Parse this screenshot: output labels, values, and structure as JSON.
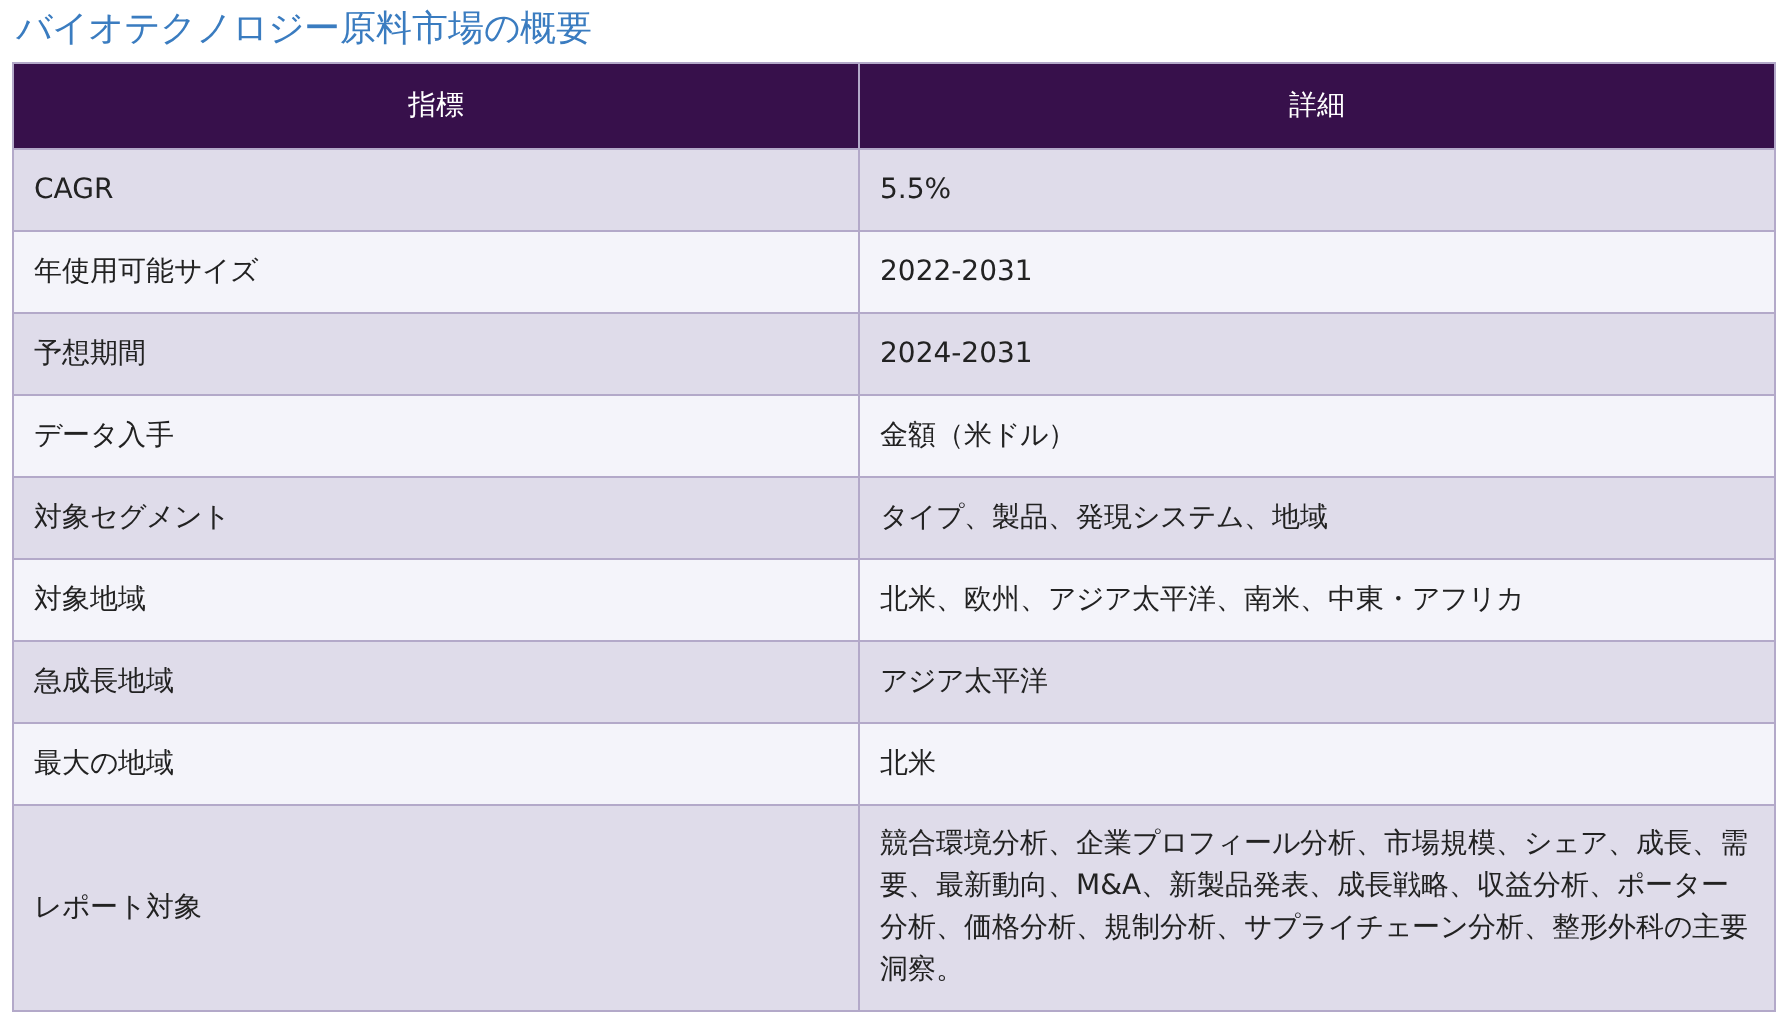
{
  "title": "バイオテクノロジー原料市場の概要",
  "table": {
    "columns": [
      "指標",
      "詳細"
    ],
    "rows": [
      {
        "label": "CAGR",
        "value": "5.5%"
      },
      {
        "label": "年使用可能サイズ",
        "value": "2022-2031"
      },
      {
        "label": "予想期間",
        "value": "2024-2031"
      },
      {
        "label": "データ入手",
        "value": "金額（米ドル）"
      },
      {
        "label": "対象セグメント",
        "value": "タイプ、製品、発現システム、地域"
      },
      {
        "label": "対象地域",
        "value": "北米、欧州、アジア太平洋、南米、中東・アフリカ"
      },
      {
        "label": "急成長地域",
        "value": "アジア太平洋"
      },
      {
        "label": "最大の地域",
        "value": "北米"
      },
      {
        "label": "レポート対象",
        "value": "競合環境分析、企業プロフィール分析、市場規模、シェア、成長、需要、最新動向、M&A、新製品発表、成長戦略、収益分析、ポーター分析、価格分析、規制分析、サプライチェーン分析、整形外科の主要洞察。"
      }
    ]
  }
}
